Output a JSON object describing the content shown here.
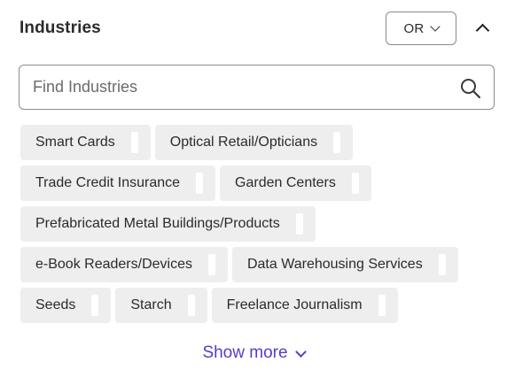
{
  "panel": {
    "title": "Industries",
    "logic_select": {
      "value": "OR",
      "icon": "chevron-down-icon"
    },
    "collapse_icon": "chevron-up-icon"
  },
  "search": {
    "placeholder": "Find Industries",
    "value": "",
    "icon": "search-icon"
  },
  "chips": [
    [
      "Smart Cards",
      "Optical Retail/Opticians"
    ],
    [
      "Trade Credit Insurance",
      "Garden Centers"
    ],
    [
      "Prefabricated Metal Buildings/Products"
    ],
    [
      "e-Book Readers/Devices",
      "Data Warehousing Services"
    ],
    [
      "Seeds",
      "Starch",
      "Freelance Journalism"
    ]
  ],
  "show_more": {
    "label": "Show more",
    "icon": "chevron-down-icon"
  },
  "colors": {
    "accent": "#5b3bc9",
    "chip_bg": "#eeeeee",
    "border": "#8c8c8c",
    "text": "#2b2b2b"
  }
}
